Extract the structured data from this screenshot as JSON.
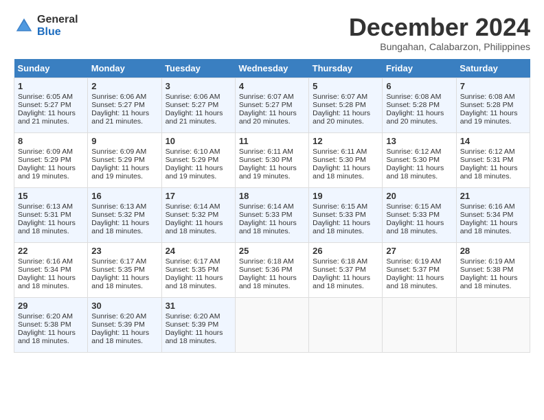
{
  "header": {
    "logo_general": "General",
    "logo_blue": "Blue",
    "month_title": "December 2024",
    "subtitle": "Bungahan, Calabarzon, Philippines"
  },
  "days_of_week": [
    "Sunday",
    "Monday",
    "Tuesday",
    "Wednesday",
    "Thursday",
    "Friday",
    "Saturday"
  ],
  "weeks": [
    [
      {
        "day": "1",
        "lines": [
          "Sunrise: 6:05 AM",
          "Sunset: 5:27 PM",
          "Daylight: 11 hours",
          "and 21 minutes."
        ]
      },
      {
        "day": "2",
        "lines": [
          "Sunrise: 6:06 AM",
          "Sunset: 5:27 PM",
          "Daylight: 11 hours",
          "and 21 minutes."
        ]
      },
      {
        "day": "3",
        "lines": [
          "Sunrise: 6:06 AM",
          "Sunset: 5:27 PM",
          "Daylight: 11 hours",
          "and 21 minutes."
        ]
      },
      {
        "day": "4",
        "lines": [
          "Sunrise: 6:07 AM",
          "Sunset: 5:27 PM",
          "Daylight: 11 hours",
          "and 20 minutes."
        ]
      },
      {
        "day": "5",
        "lines": [
          "Sunrise: 6:07 AM",
          "Sunset: 5:28 PM",
          "Daylight: 11 hours",
          "and 20 minutes."
        ]
      },
      {
        "day": "6",
        "lines": [
          "Sunrise: 6:08 AM",
          "Sunset: 5:28 PM",
          "Daylight: 11 hours",
          "and 20 minutes."
        ]
      },
      {
        "day": "7",
        "lines": [
          "Sunrise: 6:08 AM",
          "Sunset: 5:28 PM",
          "Daylight: 11 hours",
          "and 19 minutes."
        ]
      }
    ],
    [
      {
        "day": "8",
        "lines": [
          "Sunrise: 6:09 AM",
          "Sunset: 5:29 PM",
          "Daylight: 11 hours",
          "and 19 minutes."
        ]
      },
      {
        "day": "9",
        "lines": [
          "Sunrise: 6:09 AM",
          "Sunset: 5:29 PM",
          "Daylight: 11 hours",
          "and 19 minutes."
        ]
      },
      {
        "day": "10",
        "lines": [
          "Sunrise: 6:10 AM",
          "Sunset: 5:29 PM",
          "Daylight: 11 hours",
          "and 19 minutes."
        ]
      },
      {
        "day": "11",
        "lines": [
          "Sunrise: 6:11 AM",
          "Sunset: 5:30 PM",
          "Daylight: 11 hours",
          "and 19 minutes."
        ]
      },
      {
        "day": "12",
        "lines": [
          "Sunrise: 6:11 AM",
          "Sunset: 5:30 PM",
          "Daylight: 11 hours",
          "and 18 minutes."
        ]
      },
      {
        "day": "13",
        "lines": [
          "Sunrise: 6:12 AM",
          "Sunset: 5:30 PM",
          "Daylight: 11 hours",
          "and 18 minutes."
        ]
      },
      {
        "day": "14",
        "lines": [
          "Sunrise: 6:12 AM",
          "Sunset: 5:31 PM",
          "Daylight: 11 hours",
          "and 18 minutes."
        ]
      }
    ],
    [
      {
        "day": "15",
        "lines": [
          "Sunrise: 6:13 AM",
          "Sunset: 5:31 PM",
          "Daylight: 11 hours",
          "and 18 minutes."
        ]
      },
      {
        "day": "16",
        "lines": [
          "Sunrise: 6:13 AM",
          "Sunset: 5:32 PM",
          "Daylight: 11 hours",
          "and 18 minutes."
        ]
      },
      {
        "day": "17",
        "lines": [
          "Sunrise: 6:14 AM",
          "Sunset: 5:32 PM",
          "Daylight: 11 hours",
          "and 18 minutes."
        ]
      },
      {
        "day": "18",
        "lines": [
          "Sunrise: 6:14 AM",
          "Sunset: 5:33 PM",
          "Daylight: 11 hours",
          "and 18 minutes."
        ]
      },
      {
        "day": "19",
        "lines": [
          "Sunrise: 6:15 AM",
          "Sunset: 5:33 PM",
          "Daylight: 11 hours",
          "and 18 minutes."
        ]
      },
      {
        "day": "20",
        "lines": [
          "Sunrise: 6:15 AM",
          "Sunset: 5:33 PM",
          "Daylight: 11 hours",
          "and 18 minutes."
        ]
      },
      {
        "day": "21",
        "lines": [
          "Sunrise: 6:16 AM",
          "Sunset: 5:34 PM",
          "Daylight: 11 hours",
          "and 18 minutes."
        ]
      }
    ],
    [
      {
        "day": "22",
        "lines": [
          "Sunrise: 6:16 AM",
          "Sunset: 5:34 PM",
          "Daylight: 11 hours",
          "and 18 minutes."
        ]
      },
      {
        "day": "23",
        "lines": [
          "Sunrise: 6:17 AM",
          "Sunset: 5:35 PM",
          "Daylight: 11 hours",
          "and 18 minutes."
        ]
      },
      {
        "day": "24",
        "lines": [
          "Sunrise: 6:17 AM",
          "Sunset: 5:35 PM",
          "Daylight: 11 hours",
          "and 18 minutes."
        ]
      },
      {
        "day": "25",
        "lines": [
          "Sunrise: 6:18 AM",
          "Sunset: 5:36 PM",
          "Daylight: 11 hours",
          "and 18 minutes."
        ]
      },
      {
        "day": "26",
        "lines": [
          "Sunrise: 6:18 AM",
          "Sunset: 5:37 PM",
          "Daylight: 11 hours",
          "and 18 minutes."
        ]
      },
      {
        "day": "27",
        "lines": [
          "Sunrise: 6:19 AM",
          "Sunset: 5:37 PM",
          "Daylight: 11 hours",
          "and 18 minutes."
        ]
      },
      {
        "day": "28",
        "lines": [
          "Sunrise: 6:19 AM",
          "Sunset: 5:38 PM",
          "Daylight: 11 hours",
          "and 18 minutes."
        ]
      }
    ],
    [
      {
        "day": "29",
        "lines": [
          "Sunrise: 6:20 AM",
          "Sunset: 5:38 PM",
          "Daylight: 11 hours",
          "and 18 minutes."
        ]
      },
      {
        "day": "30",
        "lines": [
          "Sunrise: 6:20 AM",
          "Sunset: 5:39 PM",
          "Daylight: 11 hours",
          "and 18 minutes."
        ]
      },
      {
        "day": "31",
        "lines": [
          "Sunrise: 6:20 AM",
          "Sunset: 5:39 PM",
          "Daylight: 11 hours",
          "and 18 minutes."
        ]
      },
      {
        "day": "",
        "lines": []
      },
      {
        "day": "",
        "lines": []
      },
      {
        "day": "",
        "lines": []
      },
      {
        "day": "",
        "lines": []
      }
    ]
  ]
}
